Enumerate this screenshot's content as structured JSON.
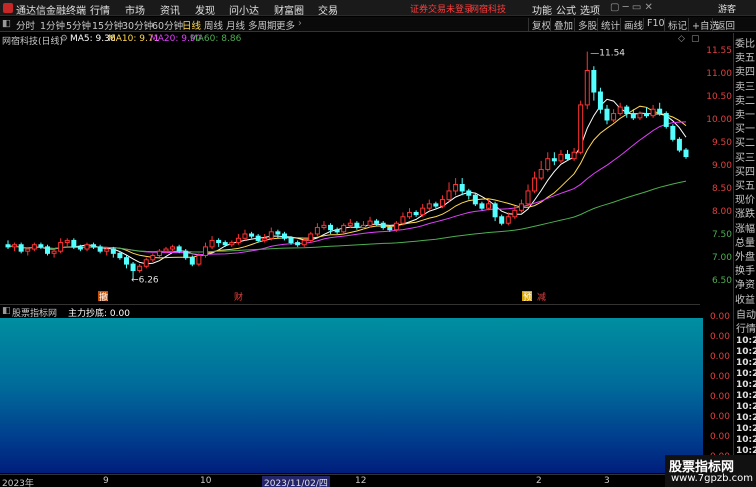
{
  "titlebar": {
    "app_name": "通达信金融终端",
    "menus": [
      "行情",
      "市场",
      "资讯",
      "发现",
      "问小达",
      "财富圈",
      "交易"
    ],
    "alert": "证券交易未登录",
    "company": "网宿科技",
    "right_menus": [
      "功能",
      "公式",
      "选项"
    ],
    "user": "游客"
  },
  "periodbar": {
    "periods": [
      "分时",
      "1分钟",
      "5分钟",
      "15分钟",
      "30分钟",
      "60分钟",
      "日线",
      "周线",
      "月线",
      "多周期",
      "更多"
    ],
    "active": "日线",
    "right_buttons": [
      "复权",
      "叠加",
      "多股",
      "统计",
      "画线",
      "F10",
      "标记",
      "+自选",
      "返回"
    ]
  },
  "chart_header": {
    "title": "网宿科技(日线)",
    "ma5": "MA5: 9.36",
    "ma10": "MA10: 9.71",
    "ma20": "MA20: 9.90",
    "ma60": "MA60: 8.86",
    "colors": {
      "ma5": "#ffffff",
      "ma10": "#ffd84d",
      "ma20": "#e040fb",
      "ma60": "#4caf50"
    }
  },
  "price_axis": {
    "ticks": [
      "11.55",
      "11.00",
      "10.50",
      "10.00",
      "9.50",
      "9.00",
      "8.50",
      "8.00",
      "7.50",
      "7.00",
      "6.50"
    ]
  },
  "chart_data": {
    "type": "candlestick",
    "annotations": {
      "high": "11.54",
      "low": "6.26"
    },
    "markers": [
      "撤",
      "财",
      "预",
      "减"
    ],
    "ylim": [
      6.3,
      11.6
    ],
    "candles": [
      [
        7.05,
        7.0,
        7.15,
        6.95
      ],
      [
        7.0,
        7.05,
        7.1,
        6.9
      ],
      [
        7.05,
        6.9,
        7.1,
        6.85
      ],
      [
        6.9,
        6.95,
        7.0,
        6.8
      ],
      [
        6.95,
        7.05,
        7.1,
        6.9
      ],
      [
        7.05,
        7.0,
        7.1,
        6.95
      ],
      [
        7.0,
        6.85,
        7.05,
        6.8
      ],
      [
        6.85,
        6.9,
        6.95,
        6.75
      ],
      [
        6.9,
        7.1,
        7.2,
        6.85
      ],
      [
        7.1,
        7.15,
        7.2,
        7.0
      ],
      [
        7.15,
        7.0,
        7.2,
        6.95
      ],
      [
        7.0,
        6.95,
        7.05,
        6.9
      ],
      [
        6.95,
        7.05,
        7.1,
        6.9
      ],
      [
        7.05,
        7.0,
        7.1,
        6.95
      ],
      [
        7.0,
        6.9,
        7.05,
        6.85
      ],
      [
        6.9,
        6.95,
        7.0,
        6.8
      ],
      [
        6.95,
        6.85,
        7.0,
        6.75
      ],
      [
        6.85,
        6.75,
        6.9,
        6.7
      ],
      [
        6.75,
        6.6,
        6.8,
        6.5
      ],
      [
        6.6,
        6.45,
        6.65,
        6.26
      ],
      [
        6.45,
        6.55,
        6.6,
        6.4
      ],
      [
        6.55,
        6.7,
        6.75,
        6.5
      ],
      [
        6.7,
        6.8,
        6.85,
        6.65
      ],
      [
        6.8,
        6.9,
        6.95,
        6.75
      ],
      [
        6.9,
        6.95,
        7.0,
        6.85
      ],
      [
        6.95,
        7.0,
        7.05,
        6.9
      ],
      [
        7.0,
        6.9,
        7.05,
        6.85
      ],
      [
        6.9,
        6.75,
        6.95,
        6.7
      ],
      [
        6.75,
        6.6,
        6.8,
        6.55
      ],
      [
        6.6,
        6.8,
        6.85,
        6.55
      ],
      [
        6.8,
        7.0,
        7.1,
        6.75
      ],
      [
        7.0,
        7.15,
        7.25,
        6.95
      ],
      [
        7.15,
        7.1,
        7.2,
        7.0
      ],
      [
        7.1,
        7.05,
        7.15,
        7.0
      ],
      [
        7.05,
        7.1,
        7.15,
        7.0
      ],
      [
        7.1,
        7.2,
        7.3,
        7.05
      ],
      [
        7.2,
        7.3,
        7.4,
        7.15
      ],
      [
        7.3,
        7.25,
        7.35,
        7.2
      ],
      [
        7.25,
        7.15,
        7.3,
        7.1
      ],
      [
        7.15,
        7.2,
        7.3,
        7.1
      ],
      [
        7.2,
        7.35,
        7.45,
        7.15
      ],
      [
        7.35,
        7.3,
        7.4,
        7.2
      ],
      [
        7.3,
        7.2,
        7.35,
        7.15
      ],
      [
        7.2,
        7.1,
        7.25,
        7.05
      ],
      [
        7.1,
        7.05,
        7.15,
        7.0
      ],
      [
        7.05,
        7.15,
        7.2,
        7.0
      ],
      [
        7.15,
        7.3,
        7.35,
        7.1
      ],
      [
        7.3,
        7.45,
        7.55,
        7.25
      ],
      [
        7.45,
        7.5,
        7.6,
        7.4
      ],
      [
        7.5,
        7.4,
        7.55,
        7.3
      ],
      [
        7.4,
        7.35,
        7.45,
        7.3
      ],
      [
        7.35,
        7.5,
        7.55,
        7.3
      ],
      [
        7.5,
        7.55,
        7.65,
        7.45
      ],
      [
        7.55,
        7.45,
        7.6,
        7.4
      ],
      [
        7.45,
        7.5,
        7.6,
        7.4
      ],
      [
        7.5,
        7.6,
        7.7,
        7.45
      ],
      [
        7.6,
        7.55,
        7.65,
        7.5
      ],
      [
        7.55,
        7.45,
        7.6,
        7.4
      ],
      [
        7.45,
        7.4,
        7.5,
        7.35
      ],
      [
        7.4,
        7.55,
        7.6,
        7.35
      ],
      [
        7.55,
        7.7,
        7.8,
        7.5
      ],
      [
        7.7,
        7.8,
        7.9,
        7.65
      ],
      [
        7.8,
        7.75,
        7.85,
        7.7
      ],
      [
        7.75,
        7.9,
        8.0,
        7.7
      ],
      [
        7.9,
        8.0,
        8.1,
        7.85
      ],
      [
        8.0,
        7.95,
        8.05,
        7.9
      ],
      [
        7.95,
        8.1,
        8.2,
        7.9
      ],
      [
        8.1,
        8.3,
        8.5,
        8.05
      ],
      [
        8.3,
        8.45,
        8.6,
        8.2
      ],
      [
        8.45,
        8.3,
        8.6,
        8.2
      ],
      [
        8.3,
        8.2,
        8.35,
        8.1
      ],
      [
        8.2,
        8.0,
        8.25,
        7.95
      ],
      [
        8.0,
        7.9,
        8.05,
        7.85
      ],
      [
        7.9,
        8.0,
        8.1,
        7.85
      ],
      [
        8.0,
        7.7,
        8.05,
        7.6
      ],
      [
        7.7,
        7.55,
        7.75,
        7.5
      ],
      [
        7.55,
        7.7,
        7.8,
        7.5
      ],
      [
        7.7,
        7.85,
        7.95,
        7.65
      ],
      [
        7.85,
        8.0,
        8.1,
        7.8
      ],
      [
        8.0,
        8.3,
        8.45,
        7.95
      ],
      [
        8.3,
        8.6,
        8.75,
        8.25
      ],
      [
        8.6,
        8.8,
        9.0,
        8.55
      ],
      [
        8.8,
        9.05,
        9.2,
        8.75
      ],
      [
        9.05,
        9.0,
        9.2,
        8.9
      ],
      [
        9.0,
        9.15,
        9.25,
        8.95
      ],
      [
        9.15,
        9.05,
        9.25,
        9.0
      ],
      [
        9.05,
        9.2,
        9.3,
        9.0
      ],
      [
        9.2,
        10.3,
        10.4,
        9.15
      ],
      [
        10.3,
        11.1,
        11.54,
        10.2
      ],
      [
        11.1,
        10.6,
        11.2,
        10.4
      ],
      [
        10.6,
        10.2,
        10.7,
        10.1
      ],
      [
        10.2,
        9.95,
        10.3,
        9.85
      ],
      [
        9.95,
        10.1,
        10.2,
        9.9
      ],
      [
        10.1,
        10.25,
        10.35,
        10.05
      ],
      [
        10.25,
        10.1,
        10.3,
        10.0
      ],
      [
        10.1,
        10.0,
        10.2,
        9.95
      ],
      [
        10.0,
        10.1,
        10.15,
        9.95
      ],
      [
        10.1,
        10.05,
        10.25,
        10.0
      ],
      [
        10.05,
        10.2,
        10.3,
        10.0
      ],
      [
        10.2,
        10.1,
        10.35,
        10.05
      ],
      [
        10.1,
        9.8,
        10.15,
        9.75
      ],
      [
        9.8,
        9.5,
        9.85,
        9.45
      ],
      [
        9.5,
        9.25,
        9.55,
        9.2
      ],
      [
        9.25,
        9.1,
        9.3,
        9.05
      ]
    ]
  },
  "indicator": {
    "name": "股票指标网",
    "label": "主力抄底: 0.00",
    "ticks": [
      "0.00",
      "0.00",
      "0.00",
      "0.00",
      "0.00",
      "0.00",
      "0.00",
      "0.00"
    ]
  },
  "side_panel": {
    "items": [
      "委比",
      "卖五",
      "卖四",
      "卖三",
      "卖二",
      "卖一",
      "买一",
      "买二",
      "买三",
      "买四",
      "买五",
      "现价",
      "涨跌",
      "涨幅",
      "总量",
      "外盘",
      "换手",
      "净资",
      "收益"
    ]
  },
  "tick_list": {
    "head": [
      "自动",
      "行情"
    ],
    "rows": [
      "10:27",
      "10:27",
      "10:27",
      "10:27",
      "10:27",
      "10:27",
      "10:27",
      "10:27",
      "10:27",
      "10:27",
      "10:27",
      "10:27",
      "10:27"
    ]
  },
  "time_axis": {
    "labels": [
      "2023年",
      "9",
      "10",
      "2023/11/02/四",
      "12",
      "2",
      "3"
    ],
    "selected": "2023/11/02/四"
  },
  "watermark": {
    "line1": "股票指标网",
    "line2": "www.7gpzb.com"
  }
}
